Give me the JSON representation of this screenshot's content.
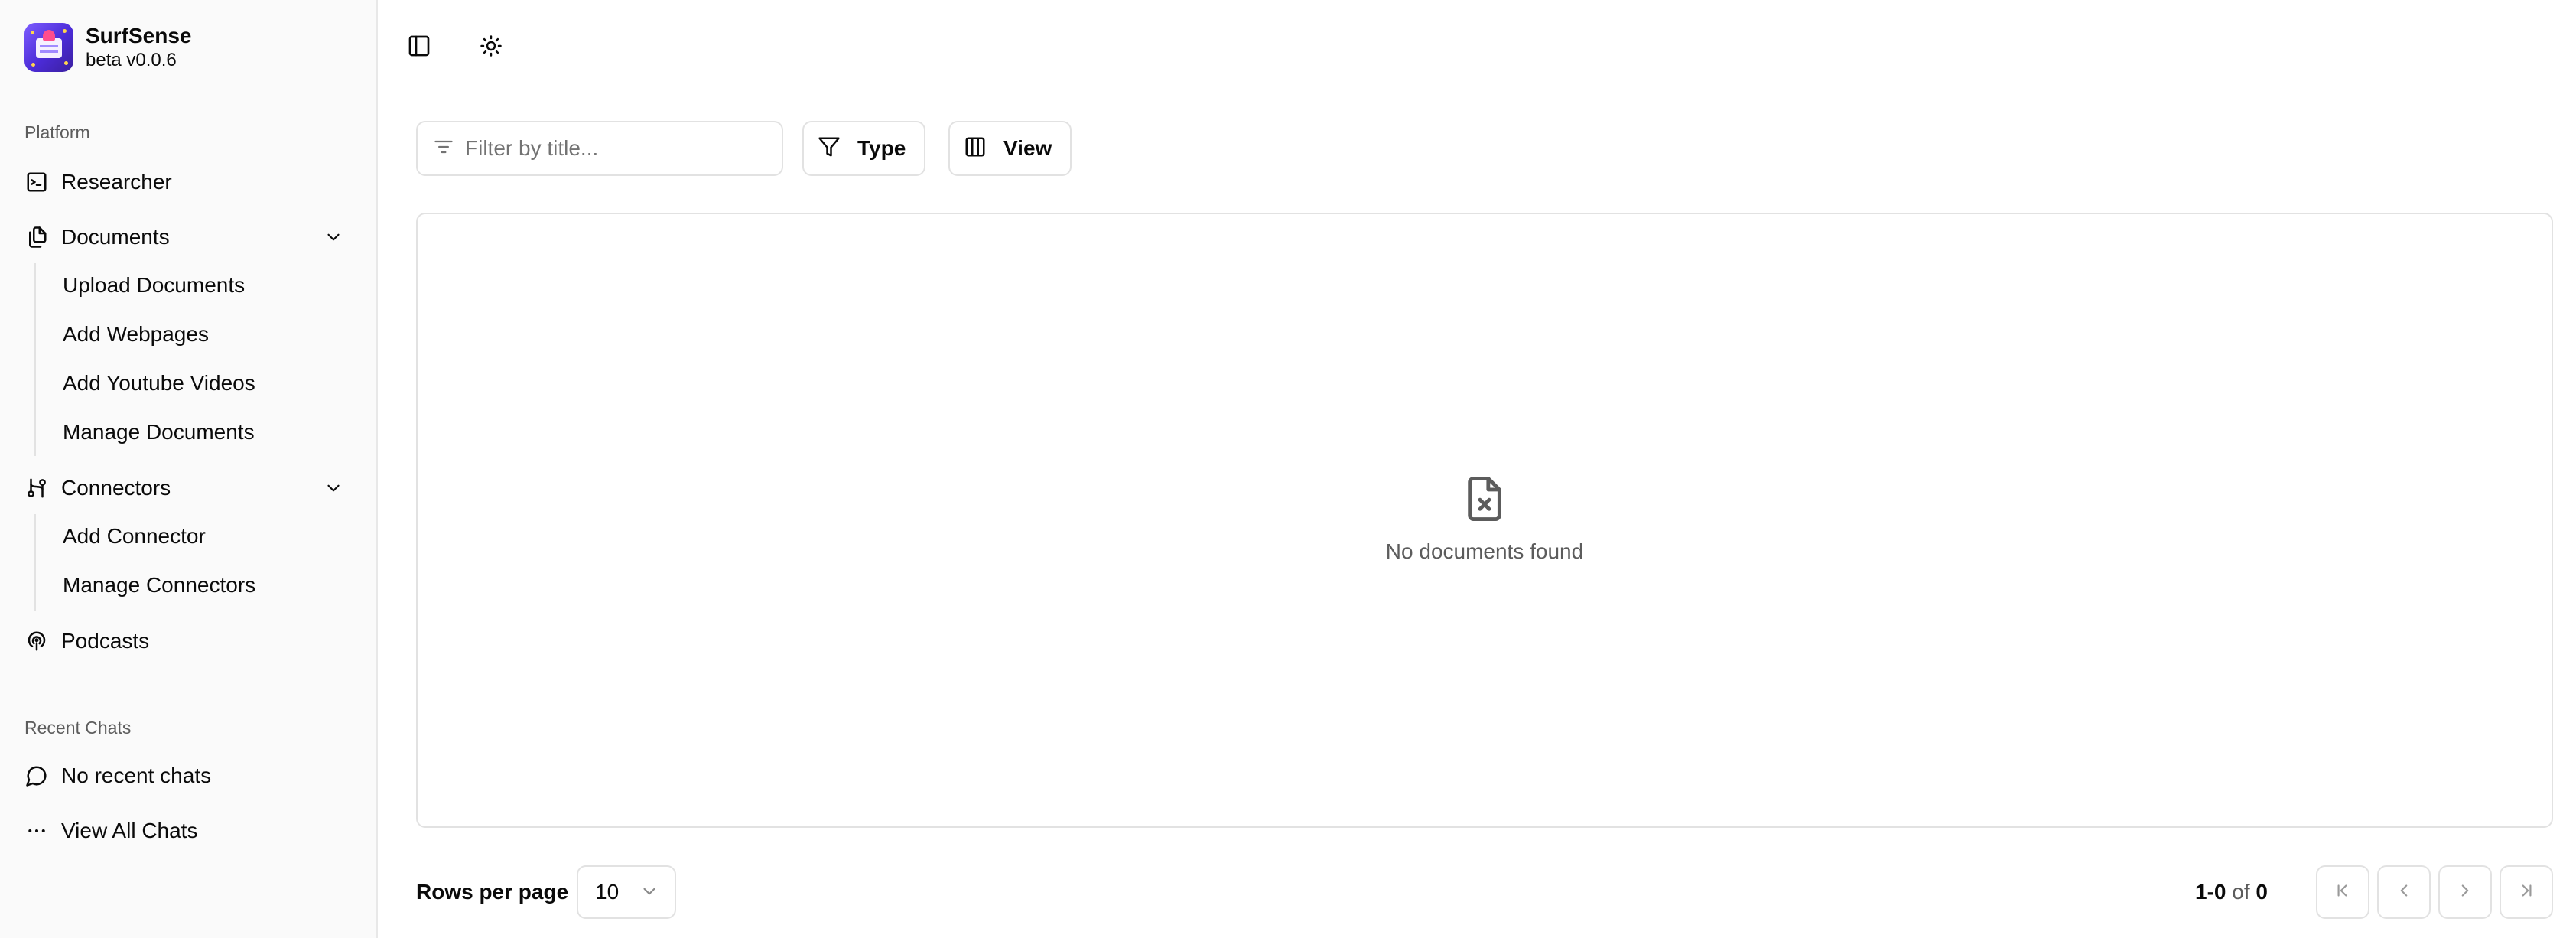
{
  "app": {
    "name": "SurfSense",
    "version": "beta v0.0.6"
  },
  "sidebar": {
    "platform_label": "Platform",
    "items": [
      {
        "label": "Researcher",
        "icon": "terminal-icon"
      },
      {
        "label": "Documents",
        "icon": "documents-icon",
        "expanded": true,
        "children": [
          "Upload Documents",
          "Add Webpages",
          "Add Youtube Videos",
          "Manage Documents"
        ]
      },
      {
        "label": "Connectors",
        "icon": "connectors-icon",
        "expanded": true,
        "children": [
          "Add Connector",
          "Manage Connectors"
        ]
      },
      {
        "label": "Podcasts",
        "icon": "podcast-icon"
      }
    ],
    "recent_label": "Recent Chats",
    "recent_items": [
      {
        "label": "No recent chats",
        "icon": "chat-bubble-icon"
      },
      {
        "label": "View All Chats",
        "icon": "more-horizontal-icon"
      }
    ]
  },
  "toolbar": {
    "filter_placeholder": "Filter by title...",
    "type_label": "Type",
    "view_label": "View"
  },
  "table": {
    "empty_message": "No documents found"
  },
  "pagination": {
    "rows_per_page_label": "Rows per page",
    "rows_per_page_value": "10",
    "range": "1-0",
    "of_word": "of",
    "total": "0"
  }
}
